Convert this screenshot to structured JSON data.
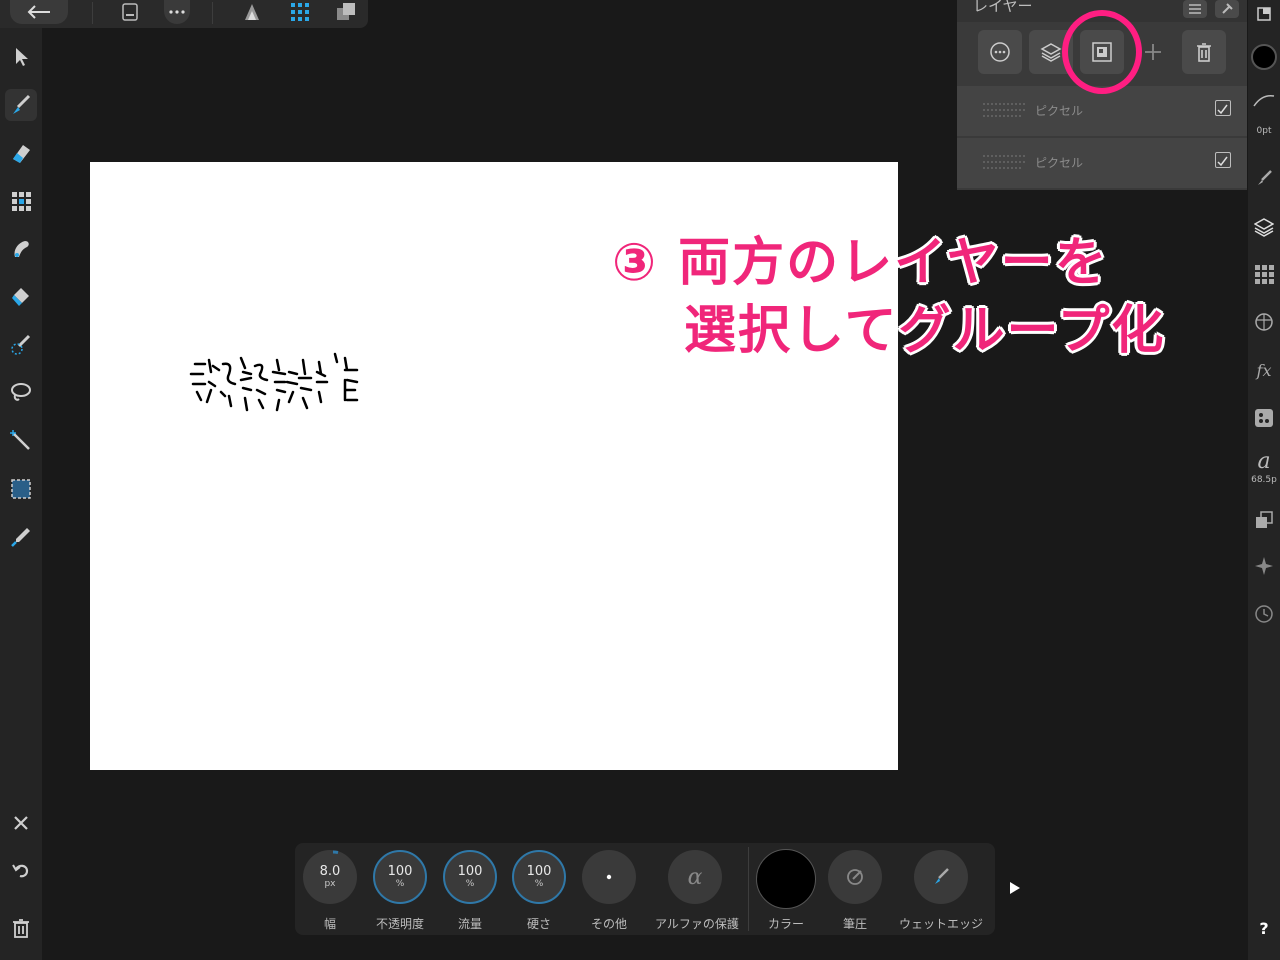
{
  "layers_panel": {
    "title": "レイヤー",
    "rows": [
      {
        "name": "ピクセル",
        "checked": true
      },
      {
        "name": "ピクセル",
        "checked": true
      }
    ]
  },
  "annotation": {
    "line1": "③ 両方のレイヤーを",
    "line2": "選択してグループ化",
    "color": "#f0267a"
  },
  "right_strip": {
    "stroke_width": "0pt",
    "font_size": "68.5p",
    "help": "?"
  },
  "context_toolbar": {
    "width": {
      "value": "8.0",
      "unit": "px",
      "label": "幅"
    },
    "opacity": {
      "value": "100",
      "unit": "%",
      "label": "不透明度"
    },
    "flow": {
      "value": "100",
      "unit": "%",
      "label": "流量"
    },
    "hardness": {
      "value": "100",
      "unit": "%",
      "label": "硬さ"
    },
    "other": {
      "label": "その他"
    },
    "alpha": {
      "label": "アルファの保護"
    },
    "color": {
      "label": "カラー",
      "value": "#000000"
    },
    "pressure": {
      "label": "筆圧"
    },
    "wet_edge": {
      "label": "ウェットエッジ"
    }
  },
  "colors": {
    "accent_ring": "#2f78a8",
    "highlight": "#ff1e82"
  }
}
